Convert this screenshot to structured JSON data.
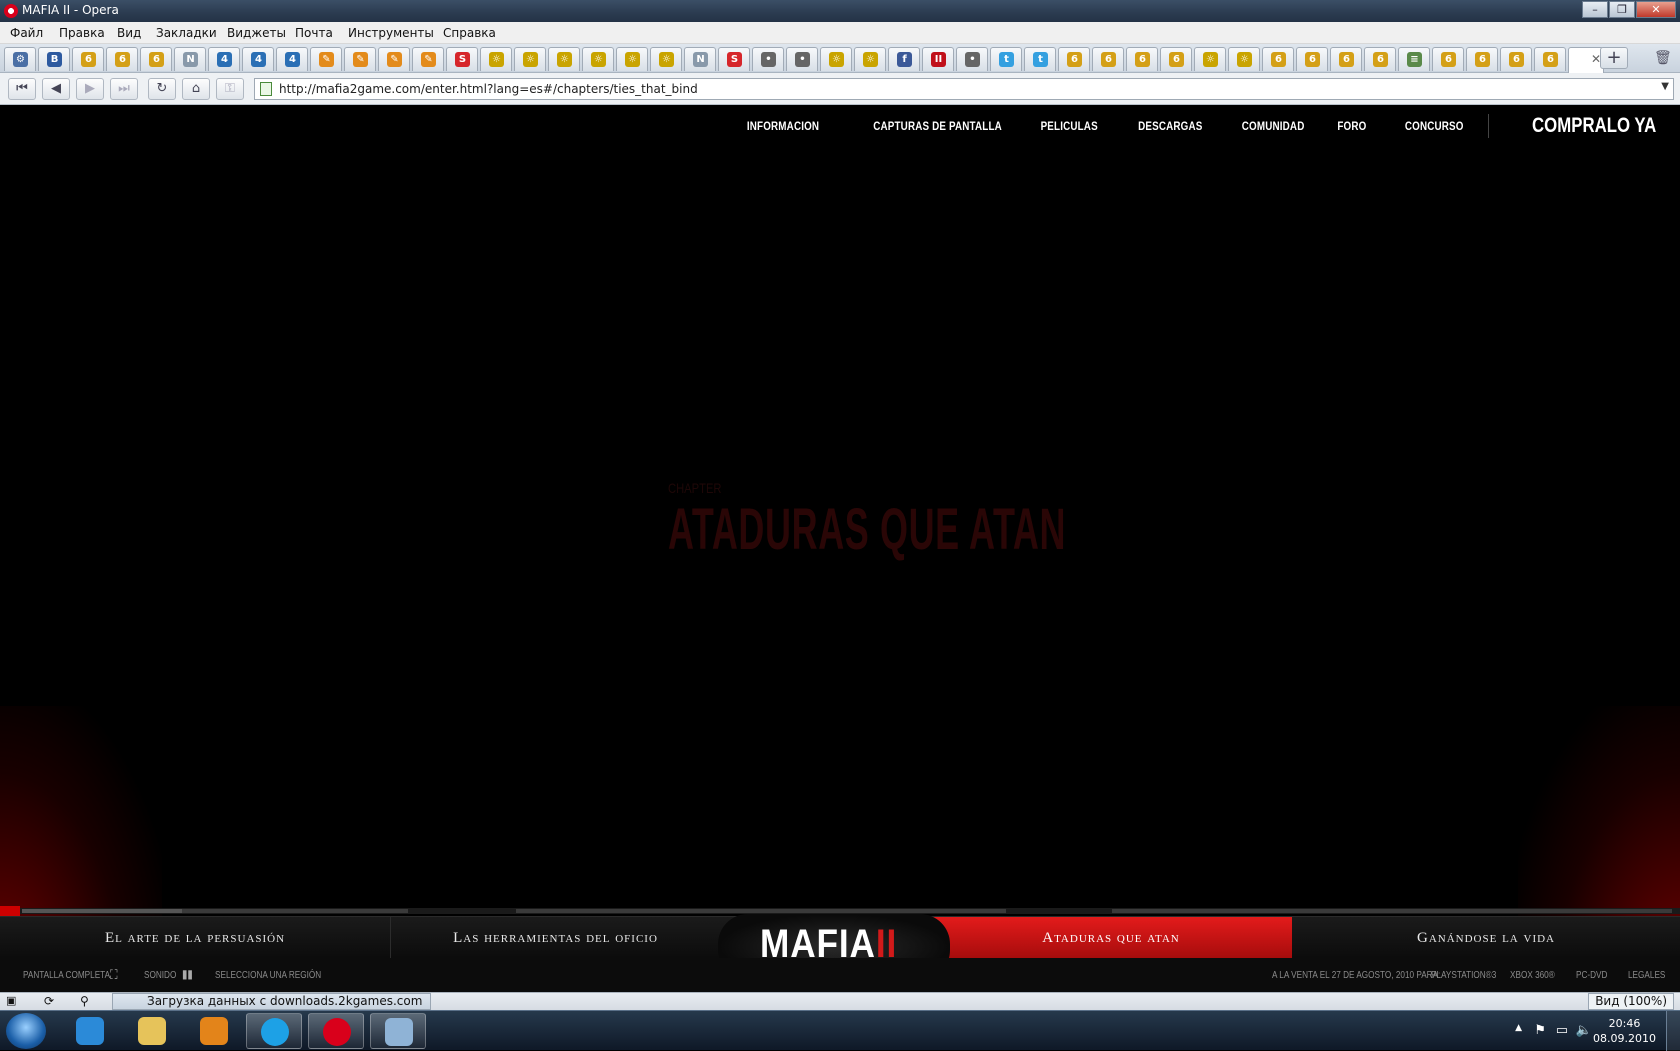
{
  "window": {
    "title": "MAFIA II - Opera",
    "controls": {
      "minimize": "–",
      "maximize": "❐",
      "close": "✕"
    }
  },
  "menu": {
    "items": [
      "Файл",
      "Правка",
      "Вид",
      "Закладки",
      "Виджеты",
      "Почта",
      "Инструменты",
      "Справка"
    ]
  },
  "tabs": {
    "icons": [
      {
        "glyph": "⚙",
        "color": "#4a6fa5"
      },
      {
        "glyph": "B",
        "color": "#2d5aa0"
      },
      {
        "glyph": "6",
        "color": "#d4a017"
      },
      {
        "glyph": "6",
        "color": "#d4a017"
      },
      {
        "glyph": "6",
        "color": "#d4a017"
      },
      {
        "glyph": "N",
        "color": "#8899aa"
      },
      {
        "glyph": "4",
        "color": "#2a6fb5"
      },
      {
        "glyph": "4",
        "color": "#2a6fb5"
      },
      {
        "glyph": "4",
        "color": "#2a6fb5"
      },
      {
        "glyph": "✎",
        "color": "#e38b1b"
      },
      {
        "glyph": "✎",
        "color": "#e38b1b"
      },
      {
        "glyph": "✎",
        "color": "#e38b1b"
      },
      {
        "glyph": "✎",
        "color": "#e38b1b"
      },
      {
        "glyph": "S",
        "color": "#d6262b"
      },
      {
        "glyph": "☼",
        "color": "#c9a400"
      },
      {
        "glyph": "☼",
        "color": "#c9a400"
      },
      {
        "glyph": "☼",
        "color": "#c9a400"
      },
      {
        "glyph": "☼",
        "color": "#c9a400"
      },
      {
        "glyph": "☼",
        "color": "#c9a400"
      },
      {
        "glyph": "☼",
        "color": "#c9a400"
      },
      {
        "glyph": "N",
        "color": "#8899aa"
      },
      {
        "glyph": "S",
        "color": "#d6262b"
      },
      {
        "glyph": "•",
        "color": "#666666"
      },
      {
        "glyph": "•",
        "color": "#666666"
      },
      {
        "glyph": "☼",
        "color": "#c9a400"
      },
      {
        "glyph": "☼",
        "color": "#c9a400"
      },
      {
        "glyph": "f",
        "color": "#3b5998"
      },
      {
        "glyph": "II",
        "color": "#c0101a"
      },
      {
        "glyph": "•",
        "color": "#666666"
      },
      {
        "glyph": "t",
        "color": "#34a0e0"
      },
      {
        "glyph": "t",
        "color": "#34a0e0"
      },
      {
        "glyph": "6",
        "color": "#d4a017"
      },
      {
        "glyph": "6",
        "color": "#d4a017"
      },
      {
        "glyph": "6",
        "color": "#d4a017"
      },
      {
        "glyph": "6",
        "color": "#d4a017"
      },
      {
        "glyph": "☼",
        "color": "#c9a400"
      },
      {
        "glyph": "☼",
        "color": "#c9a400"
      },
      {
        "glyph": "6",
        "color": "#d4a017"
      },
      {
        "glyph": "6",
        "color": "#d4a017"
      },
      {
        "glyph": "6",
        "color": "#d4a017"
      },
      {
        "glyph": "6",
        "color": "#d4a017"
      },
      {
        "glyph": "≡",
        "color": "#5a8a4a"
      },
      {
        "glyph": "6",
        "color": "#d4a017"
      },
      {
        "glyph": "6",
        "color": "#d4a017"
      },
      {
        "glyph": "6",
        "color": "#d4a017"
      },
      {
        "glyph": "6",
        "color": "#d4a017"
      }
    ],
    "active_close": "✕",
    "new_tab": "+",
    "trash": "🗑"
  },
  "nav": {
    "url": "http://mafia2game.com/enter.html?lang=es#/chapters/ties_that_bind",
    "buttons": [
      "⏮",
      "◀",
      "▶",
      "⏭",
      "↻",
      "⌂",
      "⚿"
    ]
  },
  "site": {
    "topnav": [
      "INFORMACION",
      "CAPTURAS DE PANTALLA",
      "PELICULAS",
      "DESCARGAS",
      "COMUNIDAD",
      "FORO",
      "CONCURSO"
    ],
    "buy_now": "COMPRALO YA",
    "chapter_pre": "CHAPTER",
    "chapter_title": "ATADURAS QUE ATAN",
    "chapters": [
      {
        "label": "El arte de la persuasión",
        "active": false
      },
      {
        "label": "Las herramientas del oficio",
        "active": false
      },
      {
        "label": "Ataduras que atan",
        "active": true
      },
      {
        "label": "Ganándose la vida",
        "active": false
      }
    ],
    "logo_main": "MAFIA",
    "logo_numeral": "II",
    "footer": {
      "fullscreen": "PANTALLA COMPLETA",
      "sound": "SONIDO",
      "region": "SELECCIONA UNA REGIÓN",
      "release": "A LA VENTA EL 27 DE AGOSTO, 2010 PARA:",
      "ps3": "PLAYSTATION®3",
      "xbox": "XBOX 360®",
      "pc": "PC-DVD",
      "legal": "LEGALES"
    },
    "accent": "#d21a1a"
  },
  "status": {
    "loading": "Загрузка данных с downloads.2kgames.com",
    "zoom": "Вид (100%)"
  },
  "taskbar": {
    "time": "20:46",
    "date": "08.09.2010"
  }
}
